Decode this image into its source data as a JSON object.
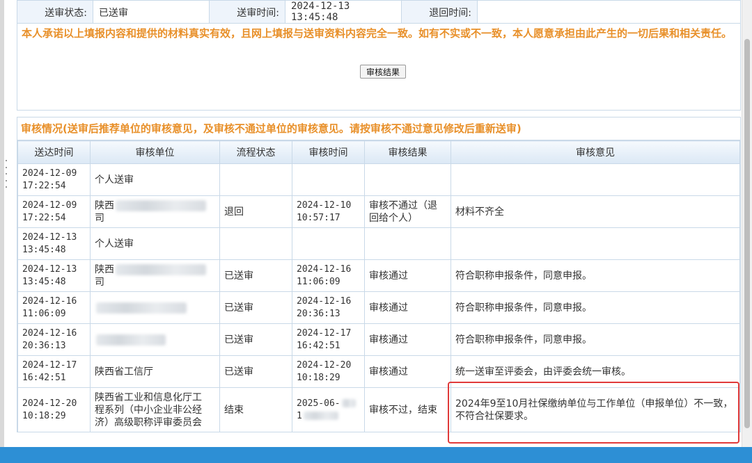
{
  "info": {
    "status_label": "送审状态:",
    "status_value": "已送审",
    "send_time_label": "送审时间:",
    "send_time_value_line1": "2024-12-13",
    "send_time_value_line2": "13:45:48",
    "return_time_label": "退回时间:",
    "return_time_value": ""
  },
  "promise": {
    "text": "本人承诺以上填报内容和提供的材料真实有效，且网上填报与送审资料内容完全一致。如有不实或不一致，本人愿意承担由此产生的一切后果和相关责任。",
    "button_label": "审核结果"
  },
  "review": {
    "title": "审核情况(送审后推荐单位的审核意见，及审核不通过单位的审核意见。请按审核不通过意见修改后重新送审)",
    "headers": [
      "送达时间",
      "审核单位",
      "流程状态",
      "审核时间",
      "审核结果",
      "审核意见"
    ],
    "rows": [
      {
        "arrive_1": "2024-12-09",
        "arrive_2": "17:22:54",
        "unit_1": "个人送审",
        "unit_2": "",
        "unit_3": "",
        "status": "",
        "time_1": "",
        "time_2": "",
        "result": "",
        "opinion": ""
      },
      {
        "arrive_1": "2024-12-09",
        "arrive_2": "17:22:54",
        "unit_1": "陕西",
        "unit_2": "司",
        "unit_3": "",
        "status": "退回",
        "time_1": "2024-12-10",
        "time_2": "10:57:17",
        "result": "审核不通过（退回给个人）",
        "opinion": "材料不齐全"
      },
      {
        "arrive_1": "2024-12-13",
        "arrive_2": "13:45:48",
        "unit_1": "个人送审",
        "unit_2": "",
        "unit_3": "",
        "status": "",
        "time_1": "",
        "time_2": "",
        "result": "",
        "opinion": ""
      },
      {
        "arrive_1": "2024-12-13",
        "arrive_2": "13:45:48",
        "unit_1": "陕西",
        "unit_2": "司",
        "unit_3": "",
        "status": "已送审",
        "time_1": "2024-12-16",
        "time_2": "11:06:09",
        "result": "审核通过",
        "opinion": "符合职称申报条件，同意申报。"
      },
      {
        "arrive_1": "2024-12-16",
        "arrive_2": "11:06:09",
        "unit_1": "",
        "unit_2": "",
        "unit_3": "",
        "status": "已送审",
        "time_1": "2024-12-16",
        "time_2": "20:36:13",
        "result": "审核通过",
        "opinion": "符合职称申报条件，同意申报。"
      },
      {
        "arrive_1": "2024-12-16",
        "arrive_2": "20:36:13",
        "unit_1": "",
        "unit_2": "",
        "unit_3": "",
        "status": "已送审",
        "time_1": "2024-12-17",
        "time_2": "16:42:51",
        "result": "审核通过",
        "opinion": "符合职称申报条件，同意申报。"
      },
      {
        "arrive_1": "2024-12-17",
        "arrive_2": "16:42:51",
        "unit_1": "陕西省工信厅",
        "unit_2": "",
        "unit_3": "",
        "status": "已送审",
        "time_1": "2024-12-20",
        "time_2": "10:18:29",
        "result": "审核通过",
        "opinion": "统一送审至评委会，由评委会统一审核。"
      },
      {
        "arrive_1": "2024-12-20",
        "arrive_2": "10:18:29",
        "unit_1": "陕西省工业和信息化厅工",
        "unit_2": "程系列（中小企业非公经",
        "unit_3": "济）高级职称评审委员会",
        "status": "结束",
        "time_1": "2025-06-",
        "time_2": "1",
        "result": "审核不过，结束",
        "opinion": "2024年9至10月社保缴纳单位与工作单位（申报单位）不一致，不符合社保要求。"
      }
    ]
  },
  "colors": {
    "accent_orange": "#e8902a",
    "border_blue": "#c9d9e8",
    "highlight_red": "#e03a3a",
    "bottom_bar": "#2d8fd5"
  }
}
